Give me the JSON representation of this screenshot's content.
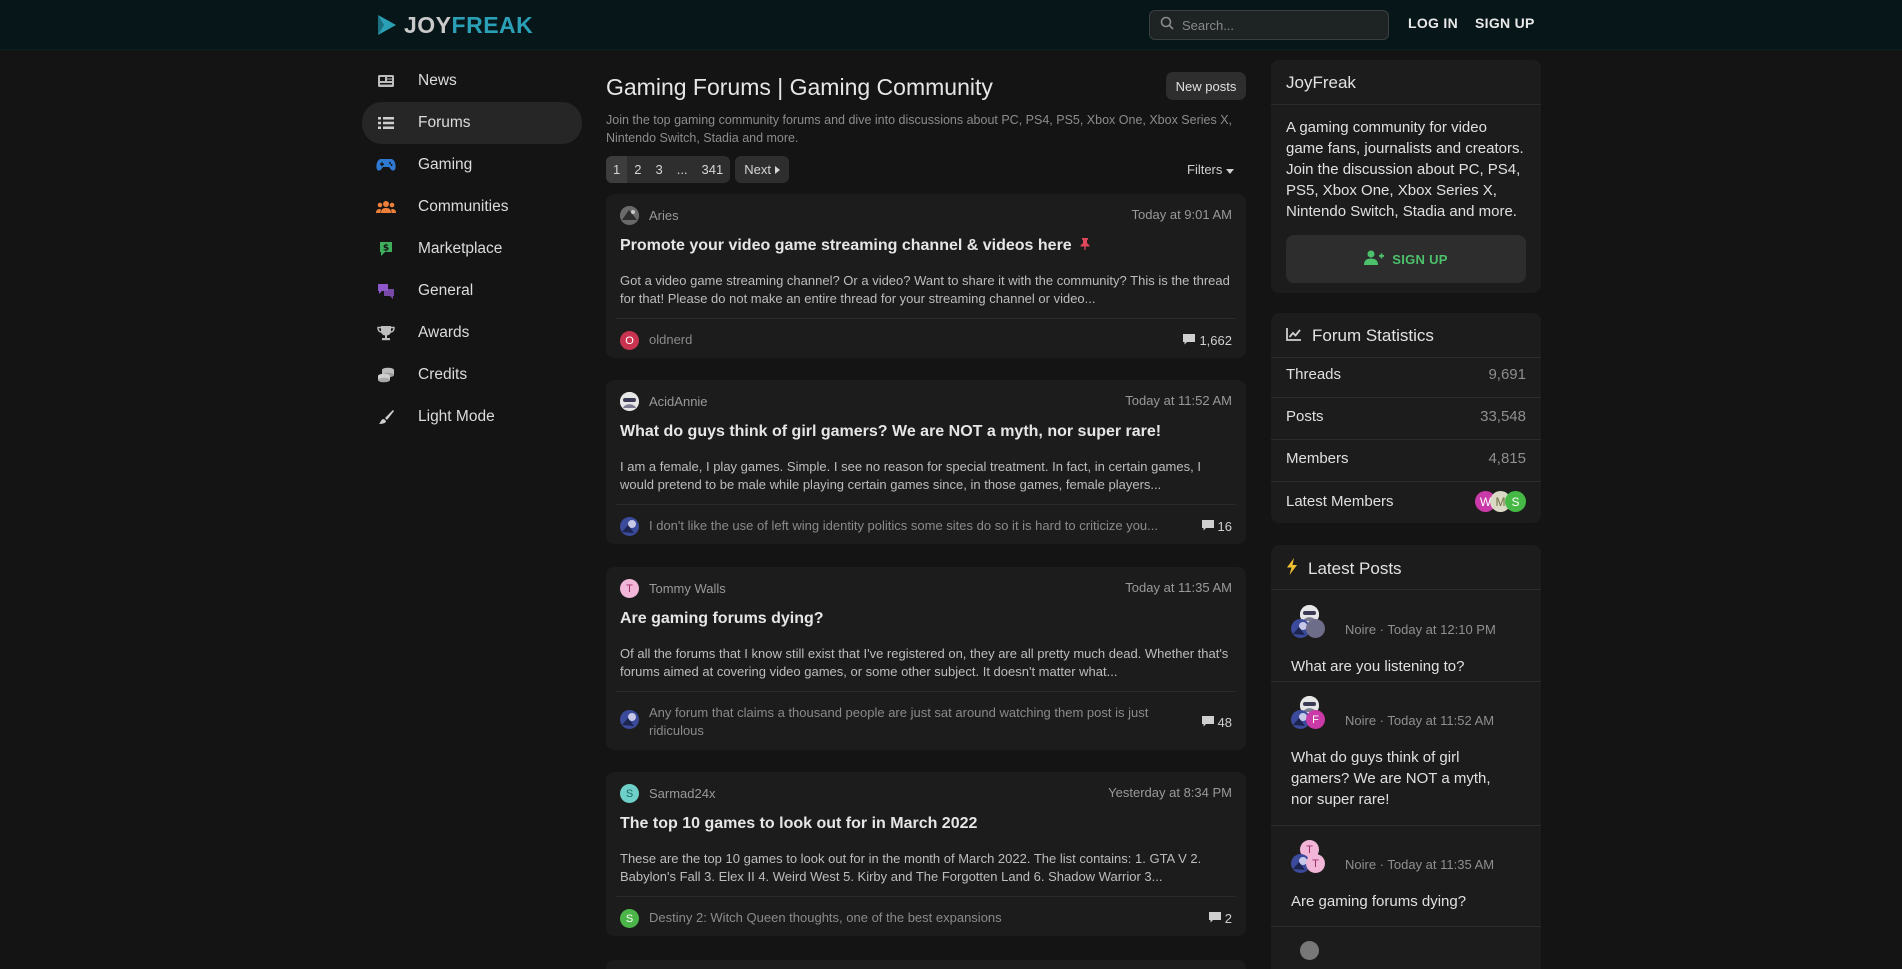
{
  "header": {
    "logo_part1": "JOY",
    "logo_part2": "FREAK",
    "search_placeholder": "Search...",
    "login": "LOG IN",
    "signup": "SIGN UP"
  },
  "sidebar": {
    "items": [
      {
        "label": "News",
        "icon": "newspaper-icon"
      },
      {
        "label": "Forums",
        "icon": "list-icon",
        "active": true
      },
      {
        "label": "Gaming",
        "icon": "gamepad-icon"
      },
      {
        "label": "Communities",
        "icon": "users-icon"
      },
      {
        "label": "Marketplace",
        "icon": "dollar-icon"
      },
      {
        "label": "General",
        "icon": "comments-icon"
      },
      {
        "label": "Awards",
        "icon": "trophy-icon"
      },
      {
        "label": "Credits",
        "icon": "coins-icon"
      },
      {
        "label": "Light Mode",
        "icon": "brush-icon"
      }
    ]
  },
  "main": {
    "title": "Gaming Forums | Gaming Community",
    "new_posts": "New posts",
    "description": "Join the top gaming community forums and dive into discussions about PC, PS4, PS5, Xbox One, Xbox Series X, Nintendo Switch, Stadia and more.",
    "pagination": {
      "pages": [
        "1",
        "2",
        "3",
        "...",
        "341"
      ],
      "next": "Next"
    },
    "filters": "Filters",
    "threads": [
      {
        "author": "Aries",
        "time": "Today at 9:01 AM",
        "title": "Promote your video game streaming channel & videos here",
        "pinned": true,
        "snippet": "Got a video game streaming channel? Or a video? Want to share it with the community? This is the thread for that! Please do not make an entire thread for your streaming channel or video...",
        "last_letter": "O",
        "last_text": "oldnerd",
        "replies": "1,662"
      },
      {
        "author": "AcidAnnie",
        "time": "Today at 11:52 AM",
        "title": "What do guys think of girl gamers? We are NOT a myth, nor super rare!",
        "snippet": "I am a female, I play games. Simple. I see no reason for special treatment. In fact, in certain games, I would pretend to be male while playing certain games since, in those games, female players...",
        "last_text": "I don't like the use of left wing identity politics some sites do so it is hard to criticize you...",
        "replies": "16"
      },
      {
        "author_letter": "T",
        "author": "Tommy Walls",
        "time": "Today at 11:35 AM",
        "title": "Are gaming forums dying?",
        "snippet": "Of all the forums that I know still exist that I've registered on, they are all pretty much dead. Whether that's forums aimed at covering video games, or some other subject. It doesn't matter what...",
        "last_text": "Any forum that claims a thousand people are just sat around watching them post is just ridiculous",
        "replies": "48"
      },
      {
        "author_letter": "S",
        "author": "Sarmad24x",
        "time": "Yesterday at 8:34 PM",
        "title": "The top 10 games to look out for in March 2022",
        "snippet": "These are the top 10 games to look out for in the month of March 2022. The list contains: 1. GTA V 2. Babylon's Fall 3. Elex II 4. Weird West 5. Kirby and The Forgotten Land 6. Shadow Warrior 3...",
        "last_letter": "S",
        "last_text": "Destiny 2: Witch Queen thoughts, one of the best expansions",
        "replies": "2"
      }
    ]
  },
  "right": {
    "about": {
      "title": "JoyFreak",
      "text": "A gaming community for video game fans, journalists and creators. Join the discussion about PC, PS4, PS5, Xbox One, Xbox Series X, Nintendo Switch, Stadia and more.",
      "signup": "SIGN UP"
    },
    "stats": {
      "title": "Forum Statistics",
      "rows": [
        {
          "label": "Threads",
          "value": "9,691"
        },
        {
          "label": "Posts",
          "value": "33,548"
        },
        {
          "label": "Members",
          "value": "4,815"
        }
      ],
      "latest_members_label": "Latest Members",
      "latest_members": [
        "W",
        "M",
        "S"
      ]
    },
    "latest": {
      "title": "Latest Posts",
      "items": [
        {
          "meta": "Noire · Today at 12:10 PM",
          "title": "What are you listening to?"
        },
        {
          "meta": "Noire · Today at 11:52 AM",
          "title": "What do guys think of girl gamers? We are NOT a myth, nor super rare!",
          "av2_letter": "F"
        },
        {
          "meta": "Noire · Today at 11:35 AM",
          "title": "Are gaming forums dying?",
          "av_top_letter": "T",
          "av2_letter": "T"
        }
      ]
    }
  },
  "colors": {
    "accent": "#2b9fb5",
    "signup_green": "#4cc06a",
    "pin_red": "#e0475b"
  }
}
